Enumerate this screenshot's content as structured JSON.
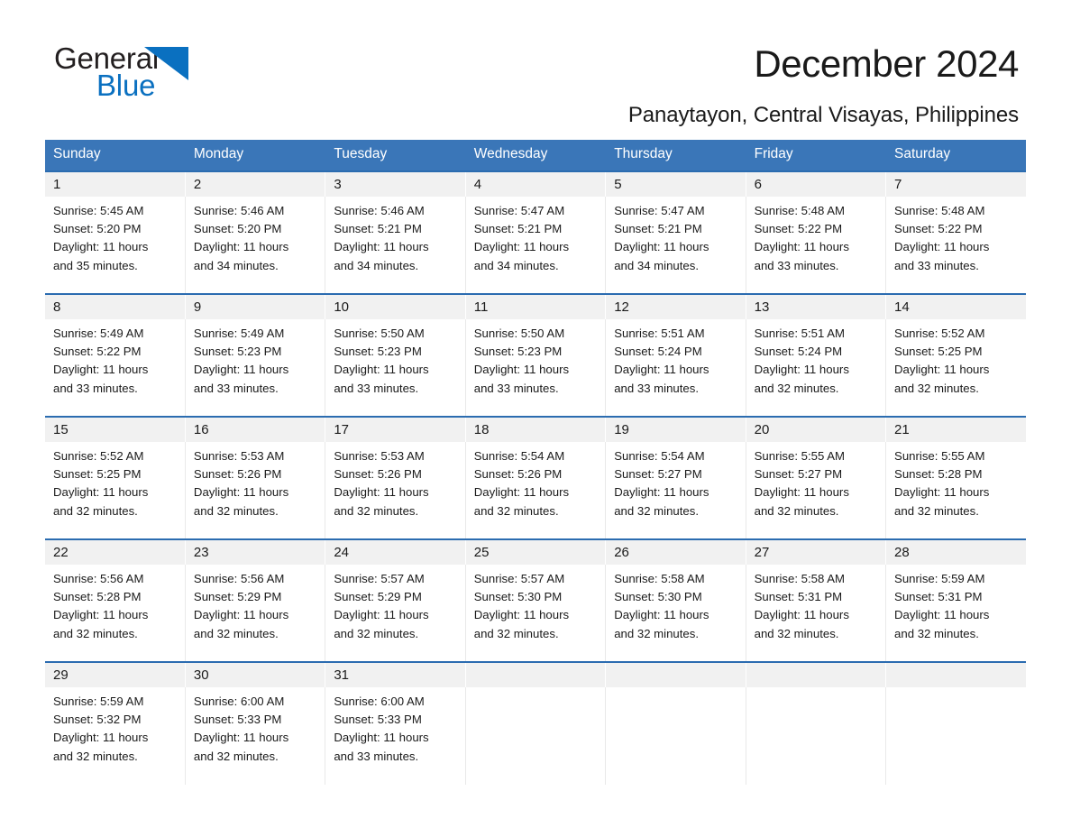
{
  "brand": {
    "name_part1": "General",
    "name_part2": "Blue",
    "triangle_color": "#0a70c0",
    "blue_text_color": "#0a70c0"
  },
  "header": {
    "title": "December 2024",
    "subtitle": "Panaytayon, Central Visayas, Philippines"
  },
  "colors": {
    "header_row_background": "#3a76b8",
    "day_number_background": "#f1f1f1",
    "week_top_border": "#2b6cb0",
    "text": "#1a1a1a"
  },
  "weekdays": [
    "Sunday",
    "Monday",
    "Tuesday",
    "Wednesday",
    "Thursday",
    "Friday",
    "Saturday"
  ],
  "weeks": [
    [
      {
        "day": "1",
        "sunrise": "Sunrise: 5:45 AM",
        "sunset": "Sunset: 5:20 PM",
        "daylight1": "Daylight: 11 hours",
        "daylight2": "and 35 minutes."
      },
      {
        "day": "2",
        "sunrise": "Sunrise: 5:46 AM",
        "sunset": "Sunset: 5:20 PM",
        "daylight1": "Daylight: 11 hours",
        "daylight2": "and 34 minutes."
      },
      {
        "day": "3",
        "sunrise": "Sunrise: 5:46 AM",
        "sunset": "Sunset: 5:21 PM",
        "daylight1": "Daylight: 11 hours",
        "daylight2": "and 34 minutes."
      },
      {
        "day": "4",
        "sunrise": "Sunrise: 5:47 AM",
        "sunset": "Sunset: 5:21 PM",
        "daylight1": "Daylight: 11 hours",
        "daylight2": "and 34 minutes."
      },
      {
        "day": "5",
        "sunrise": "Sunrise: 5:47 AM",
        "sunset": "Sunset: 5:21 PM",
        "daylight1": "Daylight: 11 hours",
        "daylight2": "and 34 minutes."
      },
      {
        "day": "6",
        "sunrise": "Sunrise: 5:48 AM",
        "sunset": "Sunset: 5:22 PM",
        "daylight1": "Daylight: 11 hours",
        "daylight2": "and 33 minutes."
      },
      {
        "day": "7",
        "sunrise": "Sunrise: 5:48 AM",
        "sunset": "Sunset: 5:22 PM",
        "daylight1": "Daylight: 11 hours",
        "daylight2": "and 33 minutes."
      }
    ],
    [
      {
        "day": "8",
        "sunrise": "Sunrise: 5:49 AM",
        "sunset": "Sunset: 5:22 PM",
        "daylight1": "Daylight: 11 hours",
        "daylight2": "and 33 minutes."
      },
      {
        "day": "9",
        "sunrise": "Sunrise: 5:49 AM",
        "sunset": "Sunset: 5:23 PM",
        "daylight1": "Daylight: 11 hours",
        "daylight2": "and 33 minutes."
      },
      {
        "day": "10",
        "sunrise": "Sunrise: 5:50 AM",
        "sunset": "Sunset: 5:23 PM",
        "daylight1": "Daylight: 11 hours",
        "daylight2": "and 33 minutes."
      },
      {
        "day": "11",
        "sunrise": "Sunrise: 5:50 AM",
        "sunset": "Sunset: 5:23 PM",
        "daylight1": "Daylight: 11 hours",
        "daylight2": "and 33 minutes."
      },
      {
        "day": "12",
        "sunrise": "Sunrise: 5:51 AM",
        "sunset": "Sunset: 5:24 PM",
        "daylight1": "Daylight: 11 hours",
        "daylight2": "and 33 minutes."
      },
      {
        "day": "13",
        "sunrise": "Sunrise: 5:51 AM",
        "sunset": "Sunset: 5:24 PM",
        "daylight1": "Daylight: 11 hours",
        "daylight2": "and 32 minutes."
      },
      {
        "day": "14",
        "sunrise": "Sunrise: 5:52 AM",
        "sunset": "Sunset: 5:25 PM",
        "daylight1": "Daylight: 11 hours",
        "daylight2": "and 32 minutes."
      }
    ],
    [
      {
        "day": "15",
        "sunrise": "Sunrise: 5:52 AM",
        "sunset": "Sunset: 5:25 PM",
        "daylight1": "Daylight: 11 hours",
        "daylight2": "and 32 minutes."
      },
      {
        "day": "16",
        "sunrise": "Sunrise: 5:53 AM",
        "sunset": "Sunset: 5:26 PM",
        "daylight1": "Daylight: 11 hours",
        "daylight2": "and 32 minutes."
      },
      {
        "day": "17",
        "sunrise": "Sunrise: 5:53 AM",
        "sunset": "Sunset: 5:26 PM",
        "daylight1": "Daylight: 11 hours",
        "daylight2": "and 32 minutes."
      },
      {
        "day": "18",
        "sunrise": "Sunrise: 5:54 AM",
        "sunset": "Sunset: 5:26 PM",
        "daylight1": "Daylight: 11 hours",
        "daylight2": "and 32 minutes."
      },
      {
        "day": "19",
        "sunrise": "Sunrise: 5:54 AM",
        "sunset": "Sunset: 5:27 PM",
        "daylight1": "Daylight: 11 hours",
        "daylight2": "and 32 minutes."
      },
      {
        "day": "20",
        "sunrise": "Sunrise: 5:55 AM",
        "sunset": "Sunset: 5:27 PM",
        "daylight1": "Daylight: 11 hours",
        "daylight2": "and 32 minutes."
      },
      {
        "day": "21",
        "sunrise": "Sunrise: 5:55 AM",
        "sunset": "Sunset: 5:28 PM",
        "daylight1": "Daylight: 11 hours",
        "daylight2": "and 32 minutes."
      }
    ],
    [
      {
        "day": "22",
        "sunrise": "Sunrise: 5:56 AM",
        "sunset": "Sunset: 5:28 PM",
        "daylight1": "Daylight: 11 hours",
        "daylight2": "and 32 minutes."
      },
      {
        "day": "23",
        "sunrise": "Sunrise: 5:56 AM",
        "sunset": "Sunset: 5:29 PM",
        "daylight1": "Daylight: 11 hours",
        "daylight2": "and 32 minutes."
      },
      {
        "day": "24",
        "sunrise": "Sunrise: 5:57 AM",
        "sunset": "Sunset: 5:29 PM",
        "daylight1": "Daylight: 11 hours",
        "daylight2": "and 32 minutes."
      },
      {
        "day": "25",
        "sunrise": "Sunrise: 5:57 AM",
        "sunset": "Sunset: 5:30 PM",
        "daylight1": "Daylight: 11 hours",
        "daylight2": "and 32 minutes."
      },
      {
        "day": "26",
        "sunrise": "Sunrise: 5:58 AM",
        "sunset": "Sunset: 5:30 PM",
        "daylight1": "Daylight: 11 hours",
        "daylight2": "and 32 minutes."
      },
      {
        "day": "27",
        "sunrise": "Sunrise: 5:58 AM",
        "sunset": "Sunset: 5:31 PM",
        "daylight1": "Daylight: 11 hours",
        "daylight2": "and 32 minutes."
      },
      {
        "day": "28",
        "sunrise": "Sunrise: 5:59 AM",
        "sunset": "Sunset: 5:31 PM",
        "daylight1": "Daylight: 11 hours",
        "daylight2": "and 32 minutes."
      }
    ],
    [
      {
        "day": "29",
        "sunrise": "Sunrise: 5:59 AM",
        "sunset": "Sunset: 5:32 PM",
        "daylight1": "Daylight: 11 hours",
        "daylight2": "and 32 minutes."
      },
      {
        "day": "30",
        "sunrise": "Sunrise: 6:00 AM",
        "sunset": "Sunset: 5:33 PM",
        "daylight1": "Daylight: 11 hours",
        "daylight2": "and 32 minutes."
      },
      {
        "day": "31",
        "sunrise": "Sunrise: 6:00 AM",
        "sunset": "Sunset: 5:33 PM",
        "daylight1": "Daylight: 11 hours",
        "daylight2": "and 33 minutes."
      },
      {
        "day": "",
        "sunrise": "",
        "sunset": "",
        "daylight1": "",
        "daylight2": ""
      },
      {
        "day": "",
        "sunrise": "",
        "sunset": "",
        "daylight1": "",
        "daylight2": ""
      },
      {
        "day": "",
        "sunrise": "",
        "sunset": "",
        "daylight1": "",
        "daylight2": ""
      },
      {
        "day": "",
        "sunrise": "",
        "sunset": "",
        "daylight1": "",
        "daylight2": ""
      }
    ]
  ]
}
